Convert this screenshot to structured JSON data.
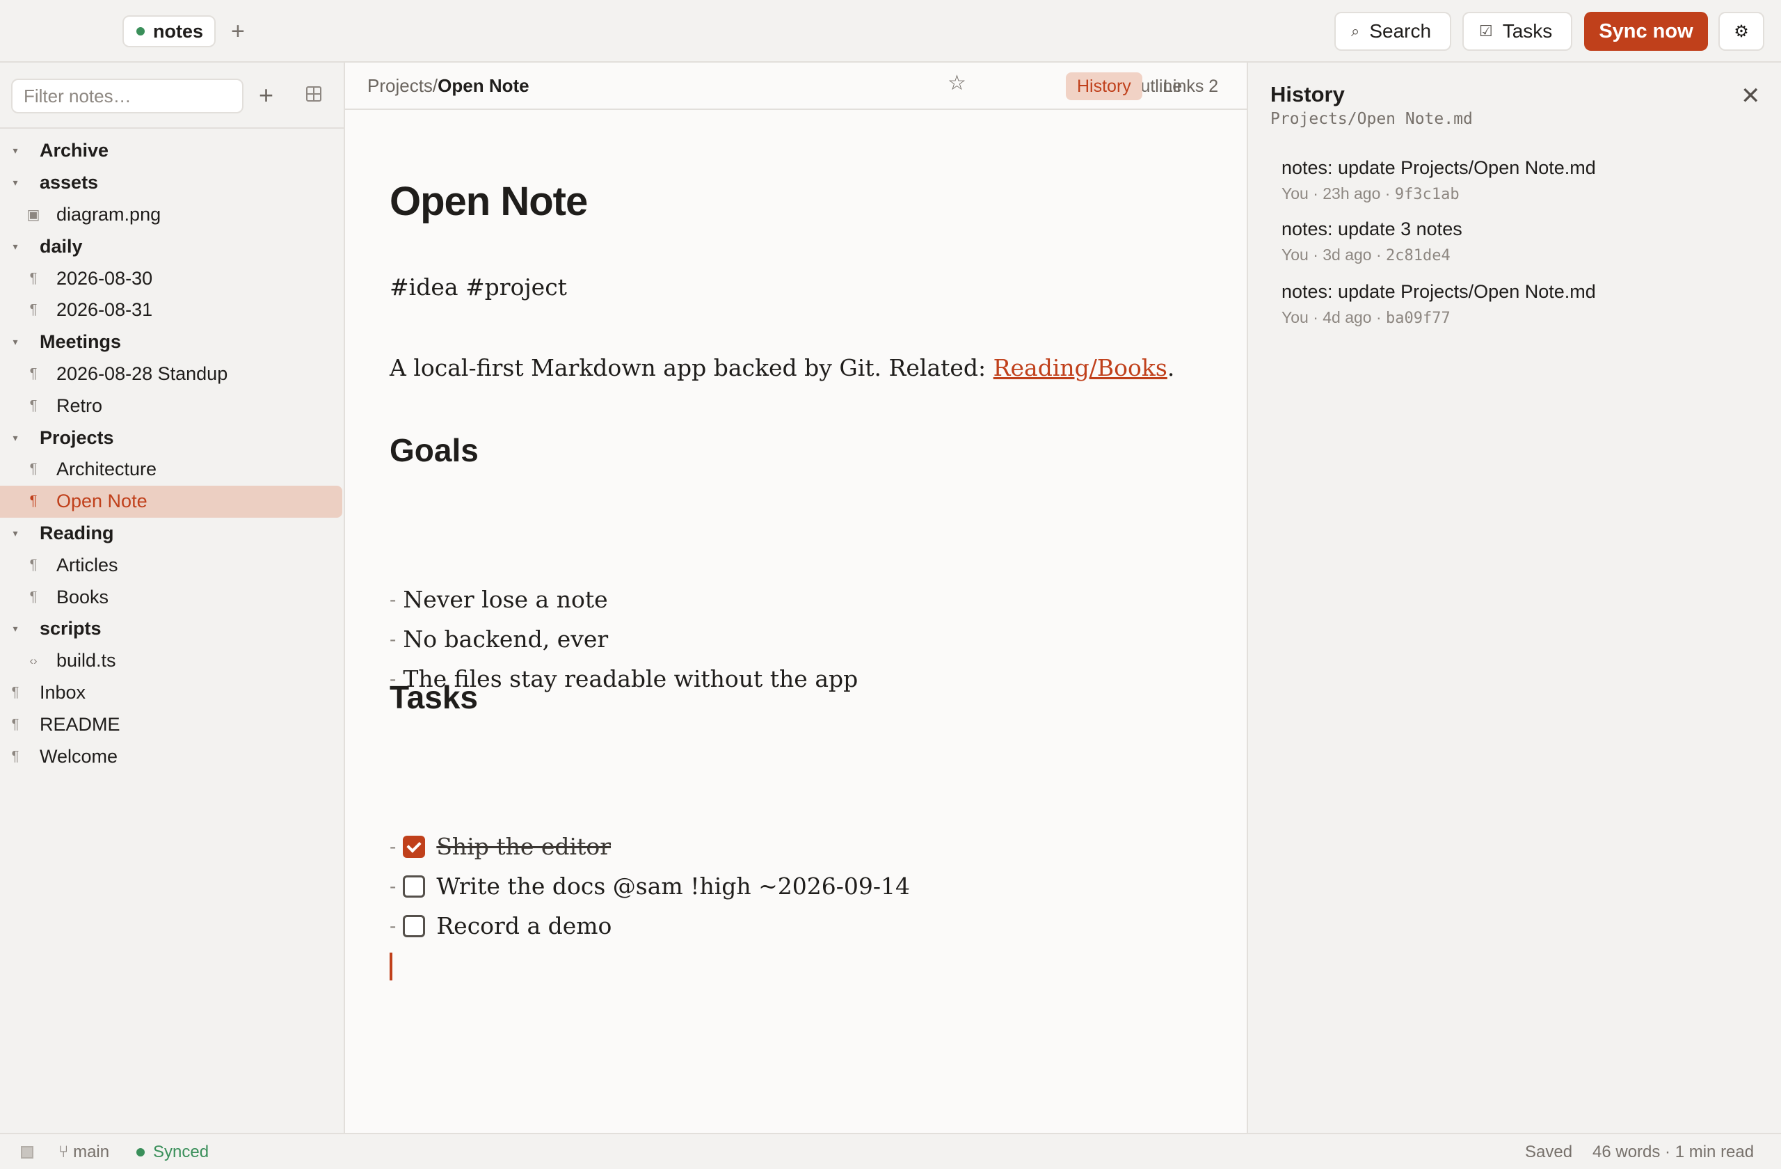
{
  "topbar": {
    "vault_name": "notes",
    "add_tab_label": "+",
    "search_label": "Search",
    "tasks_label": "Tasks",
    "sync_label": "Sync now",
    "accent_color": "#c0401b"
  },
  "sidebar": {
    "filter_placeholder": "Filter notes…",
    "add_label": "+",
    "tree": [
      {
        "label": "Archive",
        "kind": "folder"
      },
      {
        "label": "assets",
        "kind": "folder"
      },
      {
        "label": "diagram.png",
        "kind": "image"
      },
      {
        "label": "daily",
        "kind": "folder"
      },
      {
        "label": "2026-08-30",
        "kind": "note"
      },
      {
        "label": "2026-08-31",
        "kind": "note"
      },
      {
        "label": "Meetings",
        "kind": "folder"
      },
      {
        "label": "2026-08-28 Standup",
        "kind": "note"
      },
      {
        "label": "Retro",
        "kind": "note"
      },
      {
        "label": "Projects",
        "kind": "folder"
      },
      {
        "label": "Architecture",
        "kind": "note"
      },
      {
        "label": "Open Note",
        "kind": "note",
        "active": true
      },
      {
        "label": "Reading",
        "kind": "folder"
      },
      {
        "label": "Articles",
        "kind": "note"
      },
      {
        "label": "Books",
        "kind": "note"
      },
      {
        "label": "scripts",
        "kind": "folder"
      },
      {
        "label": "build.ts",
        "kind": "code"
      },
      {
        "label": "Inbox",
        "kind": "root-note"
      },
      {
        "label": "README",
        "kind": "root-note"
      },
      {
        "label": "Welcome",
        "kind": "root-note"
      }
    ]
  },
  "editor": {
    "breadcrumb_parent": "Projects/",
    "breadcrumb_current": "Open Note",
    "tabs": {
      "outline": "Outline",
      "history": "History",
      "links": "Links 2"
    },
    "doc": {
      "title": "Open Note",
      "tags": "#idea #project",
      "intro_text": "A local-first Markdown app backed by Git. Related: ",
      "intro_link": "Reading/Books",
      "intro_end": ".",
      "goals_heading": "Goals",
      "goals": [
        "Never lose a note",
        "No backend, ever",
        "The files stay readable without the app"
      ],
      "tasks_heading": "Tasks",
      "tasks": [
        {
          "text": "Ship the editor",
          "done": true
        },
        {
          "text": "Write the docs @sam !high ~2026-09-14",
          "done": false
        },
        {
          "text": "Record a demo",
          "done": false
        }
      ],
      "list_dash": "-"
    }
  },
  "history": {
    "title": "History",
    "path": "Projects/Open Note.md",
    "commits": [
      {
        "message": "notes: update Projects/Open Note.md",
        "meta": "You · 23h ago · ",
        "hash": "9f3c1ab"
      },
      {
        "message": "notes: update 3 notes",
        "meta": "You · 3d ago · ",
        "hash": "2c81de4"
      },
      {
        "message": "notes: update Projects/Open Note.md",
        "meta": "You · 4d ago · ",
        "hash": "ba09f77"
      }
    ]
  },
  "statusbar": {
    "branch": "main",
    "sync_status": "Synced",
    "save_status": "Saved",
    "stats": "46 words · 1 min read",
    "sync_color": "#3a8f5a"
  }
}
